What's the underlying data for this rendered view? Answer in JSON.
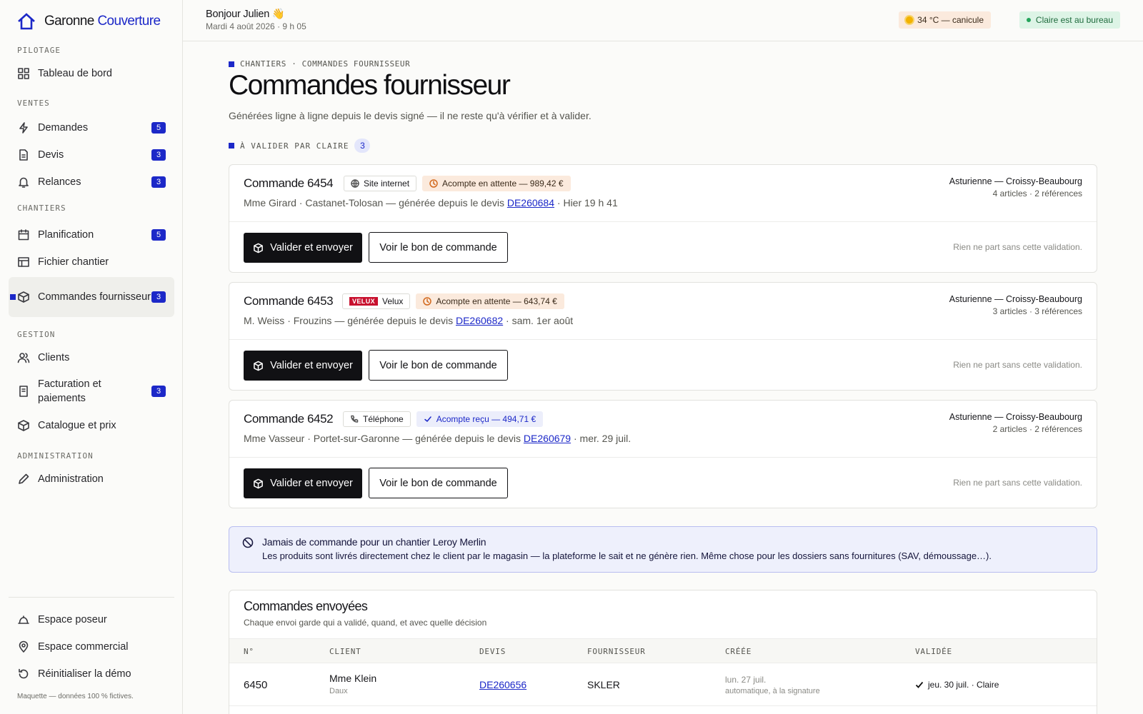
{
  "brand": {
    "name_part1": "Garonne",
    "name_part2": "Couverture"
  },
  "sidebar": {
    "sections": {
      "pilotage": "PILOTAGE",
      "ventes": "VENTES",
      "chantiers": "CHANTIERS",
      "gestion": "GESTION",
      "administration": "ADMINISTRATION"
    },
    "items": {
      "tableau": {
        "label": "Tableau de bord",
        "icon": "grid-icon"
      },
      "demandes": {
        "label": "Demandes",
        "badge": "5",
        "icon": "lightning-icon"
      },
      "devis": {
        "label": "Devis",
        "badge": "3",
        "icon": "document-icon"
      },
      "relances": {
        "label": "Relances",
        "badge": "3",
        "icon": "bell-icon"
      },
      "planification": {
        "label": "Planification",
        "badge": "5",
        "icon": "calendar-icon"
      },
      "fichier": {
        "label": "Fichier chantier",
        "icon": "table-icon"
      },
      "commandes": {
        "label": "Commandes fournisseur",
        "badge": "3",
        "icon": "box-icon"
      },
      "clients": {
        "label": "Clients",
        "icon": "users-icon"
      },
      "facturation": {
        "label": "Facturation et paiements",
        "badge": "3",
        "icon": "receipt-icon"
      },
      "catalogue": {
        "label": "Catalogue et prix",
        "icon": "cube-icon"
      },
      "administration": {
        "label": "Administration",
        "icon": "pencil-icon"
      }
    },
    "footer_items": {
      "poseur": {
        "label": "Espace poseur",
        "icon": "helmet-icon"
      },
      "commercial": {
        "label": "Espace commercial",
        "icon": "pin-icon"
      },
      "reset": {
        "label": "Réinitialiser la démo",
        "icon": "reset-icon"
      }
    },
    "footnote": "Maquette — données 100 % fictives."
  },
  "header": {
    "greeting": "Bonjour Julien 👋",
    "date": "Mardi 4 août 2026 · 9 h 05",
    "weather": "34 °C — canicule",
    "presence": "Claire est au bureau"
  },
  "page": {
    "breadcrumb": "CHANTIERS · COMMANDES FOURNISSEUR",
    "title": "Commandes fournisseur",
    "subtitle": "Générées ligne à ligne depuis le devis signé — il ne reste qu'à vérifier et à valider.",
    "pending_label": "À VALIDER PAR CLAIRE",
    "pending_count": "3"
  },
  "orders": [
    {
      "title": "Commande 6454",
      "channel": "Site internet",
      "deposit": "Acompte en attente — 989,42 €",
      "meta_before": "Mme Girard · Castanet-Tolosan — générée depuis le devis ",
      "quote": "DE260684",
      "meta_after": " · Hier 19 h 41",
      "supplier": "Asturienne — Croissy-Beaubourg",
      "items": "4 articles · 2 références",
      "primary": "Valider et envoyer",
      "secondary": "Voir le bon de commande",
      "note": "Rien ne part sans cette validation."
    },
    {
      "title": "Commande 6453",
      "channel_logo": "VELUX",
      "channel": "Velux",
      "deposit": "Acompte en attente — 643,74 €",
      "meta_before": "M. Weiss · Frouzins — générée depuis le devis ",
      "quote": "DE260682",
      "meta_after": " · sam. 1er août",
      "supplier": "Asturienne — Croissy-Beaubourg",
      "items": "3 articles · 3 références",
      "primary": "Valider et envoyer",
      "secondary": "Voir le bon de commande",
      "note": "Rien ne part sans cette validation."
    },
    {
      "title": "Commande 6452",
      "channel": "Téléphone",
      "deposit": "Acompte reçu — 494,71 €",
      "meta_before": "Mme Vasseur · Portet-sur-Garonne — générée depuis le devis ",
      "quote": "DE260679",
      "meta_after": " · mer. 29 juil.",
      "supplier": "Asturienne — Croissy-Beaubourg",
      "items": "2 articles · 2 références",
      "primary": "Valider et envoyer",
      "secondary": "Voir le bon de commande",
      "note": "Rien ne part sans cette validation."
    }
  ],
  "info": {
    "title": "Jamais de commande pour un chantier Leroy Merlin",
    "text": "Les produits sont livrés directement chez le client par le magasin — la plateforme le sait et ne génère rien. Même chose pour les dossiers sans fournitures (SAV, démoussage…)."
  },
  "sent": {
    "title": "Commandes envoyées",
    "subtitle": "Chaque envoi garde qui a validé, quand, et avec quelle décision",
    "columns": [
      "N°",
      "CLIENT",
      "DEVIS",
      "FOURNISSEUR",
      "CRÉÉE",
      "VALIDÉE"
    ],
    "rows": [
      {
        "number": "6450",
        "client": "Mme Klein",
        "client_city": "Daux",
        "quote": "DE260656",
        "supplier": "SKLER",
        "created": "lun. 27 juil.",
        "created_note": "automatique, à la signature",
        "validated": "jeu. 30 juil. · Claire"
      }
    ]
  },
  "colors": {
    "accent": "#1c28c8",
    "primary_button": "#111114",
    "warning_bg": "#fbeadd",
    "success_bg": "#ddf4e6"
  }
}
